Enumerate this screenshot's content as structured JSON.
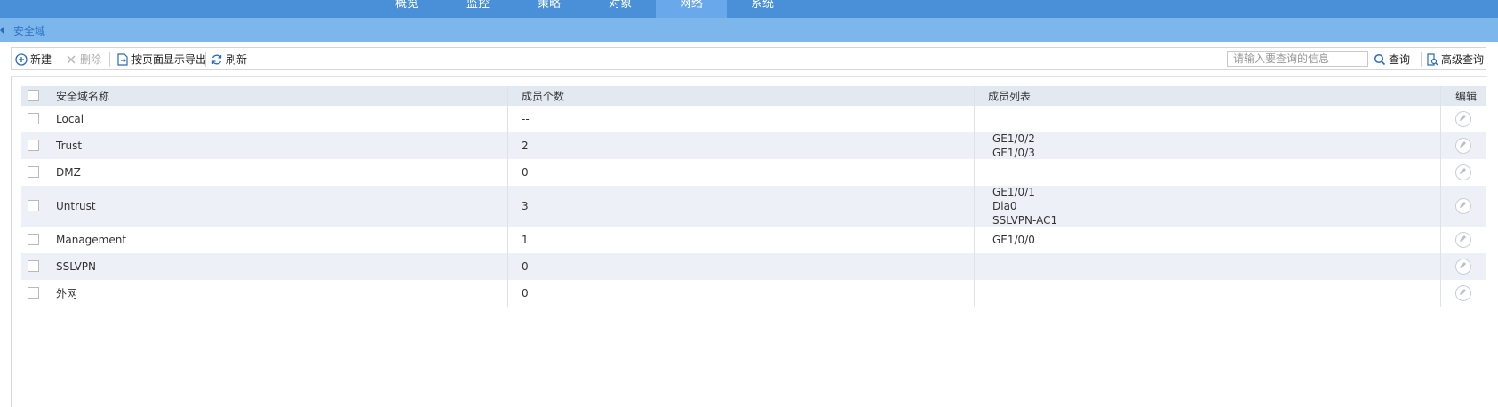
{
  "nav": {
    "tabs": [
      {
        "label": "概览",
        "active": false
      },
      {
        "label": "监控",
        "active": false
      },
      {
        "label": "策略",
        "active": false
      },
      {
        "label": "对象",
        "active": false
      },
      {
        "label": "网络",
        "active": true
      },
      {
        "label": "系统",
        "active": false
      }
    ]
  },
  "page": {
    "title": "安全域"
  },
  "toolbar": {
    "new_label": "新建",
    "delete_label": "删除",
    "export_label": "按页面显示导出",
    "refresh_label": "刷新",
    "search_placeholder": "请输入要查询的信息",
    "query_label": "查询",
    "advanced_query_label": "高级查询"
  },
  "table": {
    "headers": {
      "name": "安全域名称",
      "count": "成员个数",
      "members": "成员列表",
      "edit": "编辑"
    },
    "rows": [
      {
        "name": "Local",
        "count": "--",
        "members": ""
      },
      {
        "name": "Trust",
        "count": "2",
        "members": "GE1/0/2\nGE1/0/3"
      },
      {
        "name": "DMZ",
        "count": "0",
        "members": ""
      },
      {
        "name": "Untrust",
        "count": "3",
        "members": "GE1/0/1\nDia0\nSSLVPN-AC1"
      },
      {
        "name": "Management",
        "count": "1",
        "members": "GE1/0/0"
      },
      {
        "name": "SSLVPN",
        "count": "0",
        "members": ""
      },
      {
        "name": "外网",
        "count": "0",
        "members": ""
      }
    ]
  },
  "colors": {
    "nav_bg": "#4a90d9",
    "nav_active": "#6aa8ec",
    "titlebar_bg": "#7db6eb",
    "title_text": "#2f76c8",
    "accent": "#2a6cb8"
  }
}
